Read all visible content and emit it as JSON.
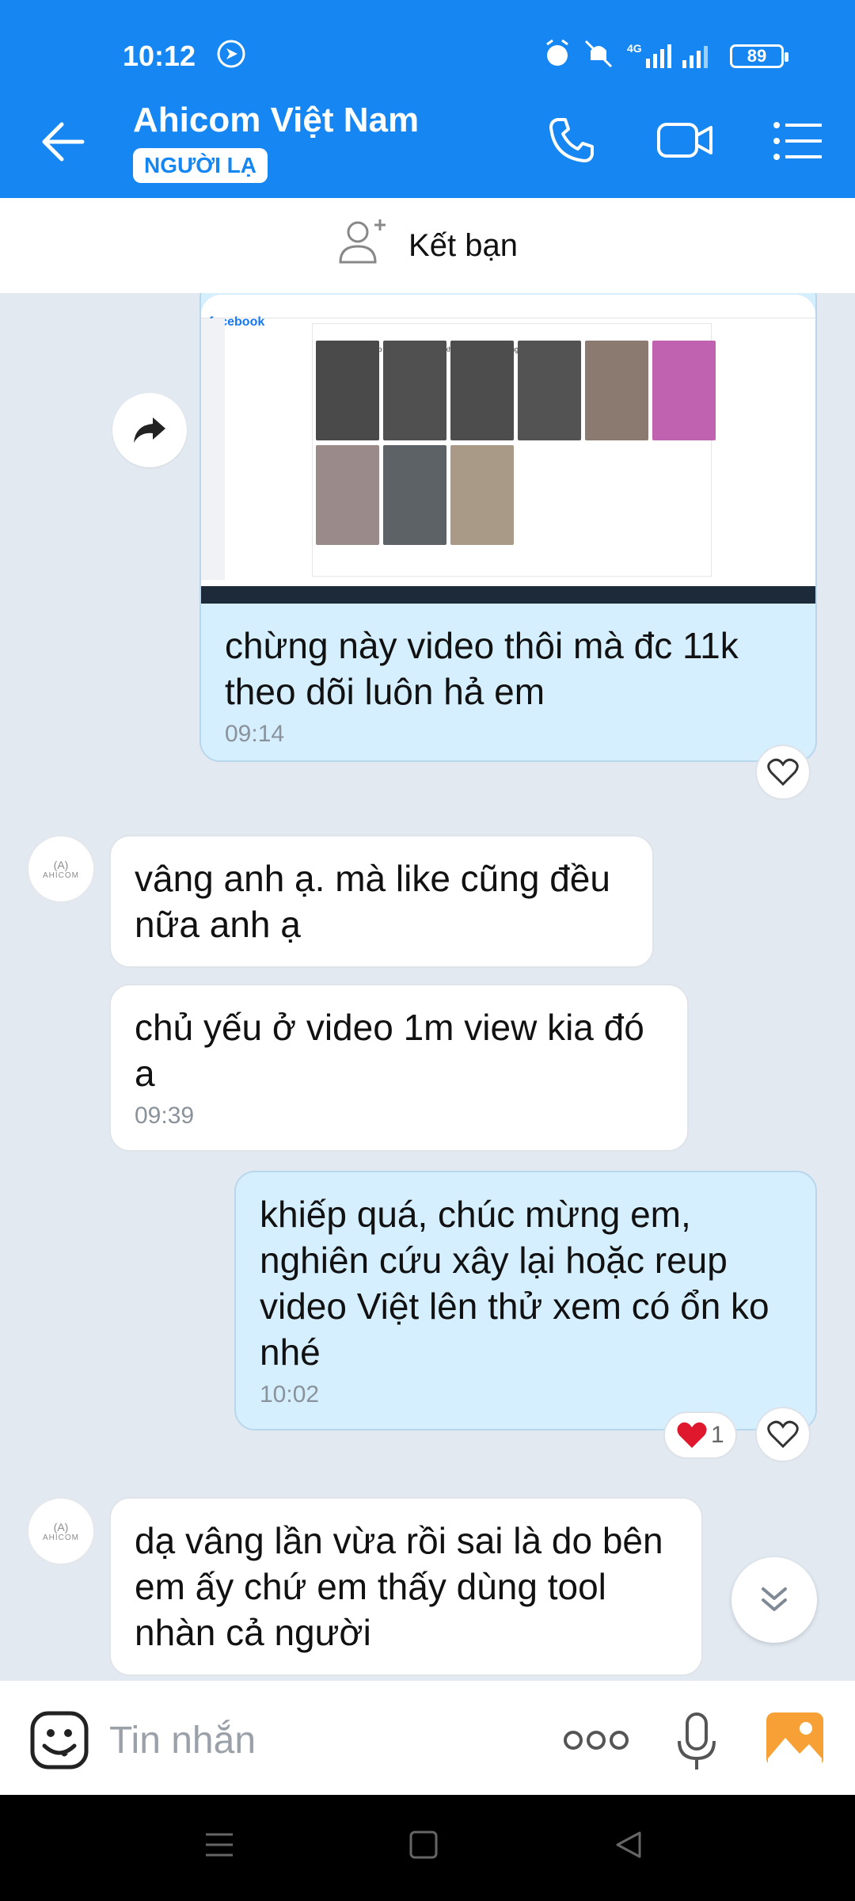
{
  "status": {
    "time": "10:12",
    "network": "4G",
    "battery": "89"
  },
  "header": {
    "title": "Ahicom Việt Nam",
    "badge": "NGƯỜI LẠ"
  },
  "friend_bar": {
    "label": "Kết bạn"
  },
  "shot": {
    "logo": "facebook",
    "panel_title": "Ahicom Shop - Dung dịch rửa xe không chạm chuyên nghiệp"
  },
  "messages": [
    {
      "text": "chừng này video thôi mà đc 11k theo dõi luôn hả em",
      "time": "09:14"
    },
    {
      "text": "vâng anh ạ. mà like cũng đều nữa anh ạ"
    },
    {
      "text": "chủ yếu ở video 1m view kia đó a",
      "time": "09:39"
    },
    {
      "text": "khiếp quá, chúc mừng em, nghiên cứu xây lại hoặc reup video Việt lên thử xem có ổn ko nhé",
      "time": "10:02",
      "reaction_count": "1"
    },
    {
      "text": "dạ vâng lần vừa rồi sai là do bên em ấy chứ em thấy dùng tool nhàn cả người"
    }
  ],
  "avatar_text": {
    "line1": "(A)",
    "line2": "AHICOM"
  },
  "input": {
    "placeholder": "Tin nhắn"
  },
  "colors": {
    "header": "#1686f2",
    "outgoing": "#d5efff",
    "incoming": "#ffffff",
    "background": "#e2e9f1"
  }
}
